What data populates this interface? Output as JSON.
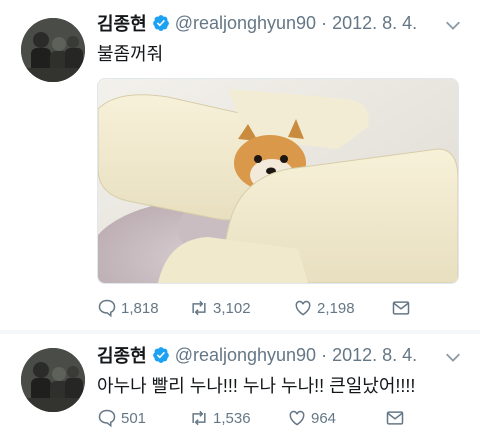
{
  "tweets": [
    {
      "author": {
        "name": "김종현",
        "handle": "@realjonghyun90",
        "verified_icon": "verified-badge-icon"
      },
      "date": "2012. 8. 4.",
      "text": "불좀꺼줘",
      "media": {
        "description_icon": "photo-icon"
      },
      "stats": {
        "replies": "1,818",
        "retweets": "3,102",
        "likes": "2,198"
      }
    },
    {
      "author": {
        "name": "김종현",
        "handle": "@realjonghyun90",
        "verified_icon": "verified-badge-icon"
      },
      "date": "2012. 8. 4.",
      "text": "아누나 빨리 누나!!! 누나 누나!! 큰일났어!!!!",
      "stats": {
        "replies": "501",
        "retweets": "1,536",
        "likes": "964"
      }
    }
  ],
  "separator": "·",
  "colors": {
    "accent": "#1da1f2",
    "muted": "#657786",
    "text": "#14171a",
    "border": "#e6ecf0"
  }
}
